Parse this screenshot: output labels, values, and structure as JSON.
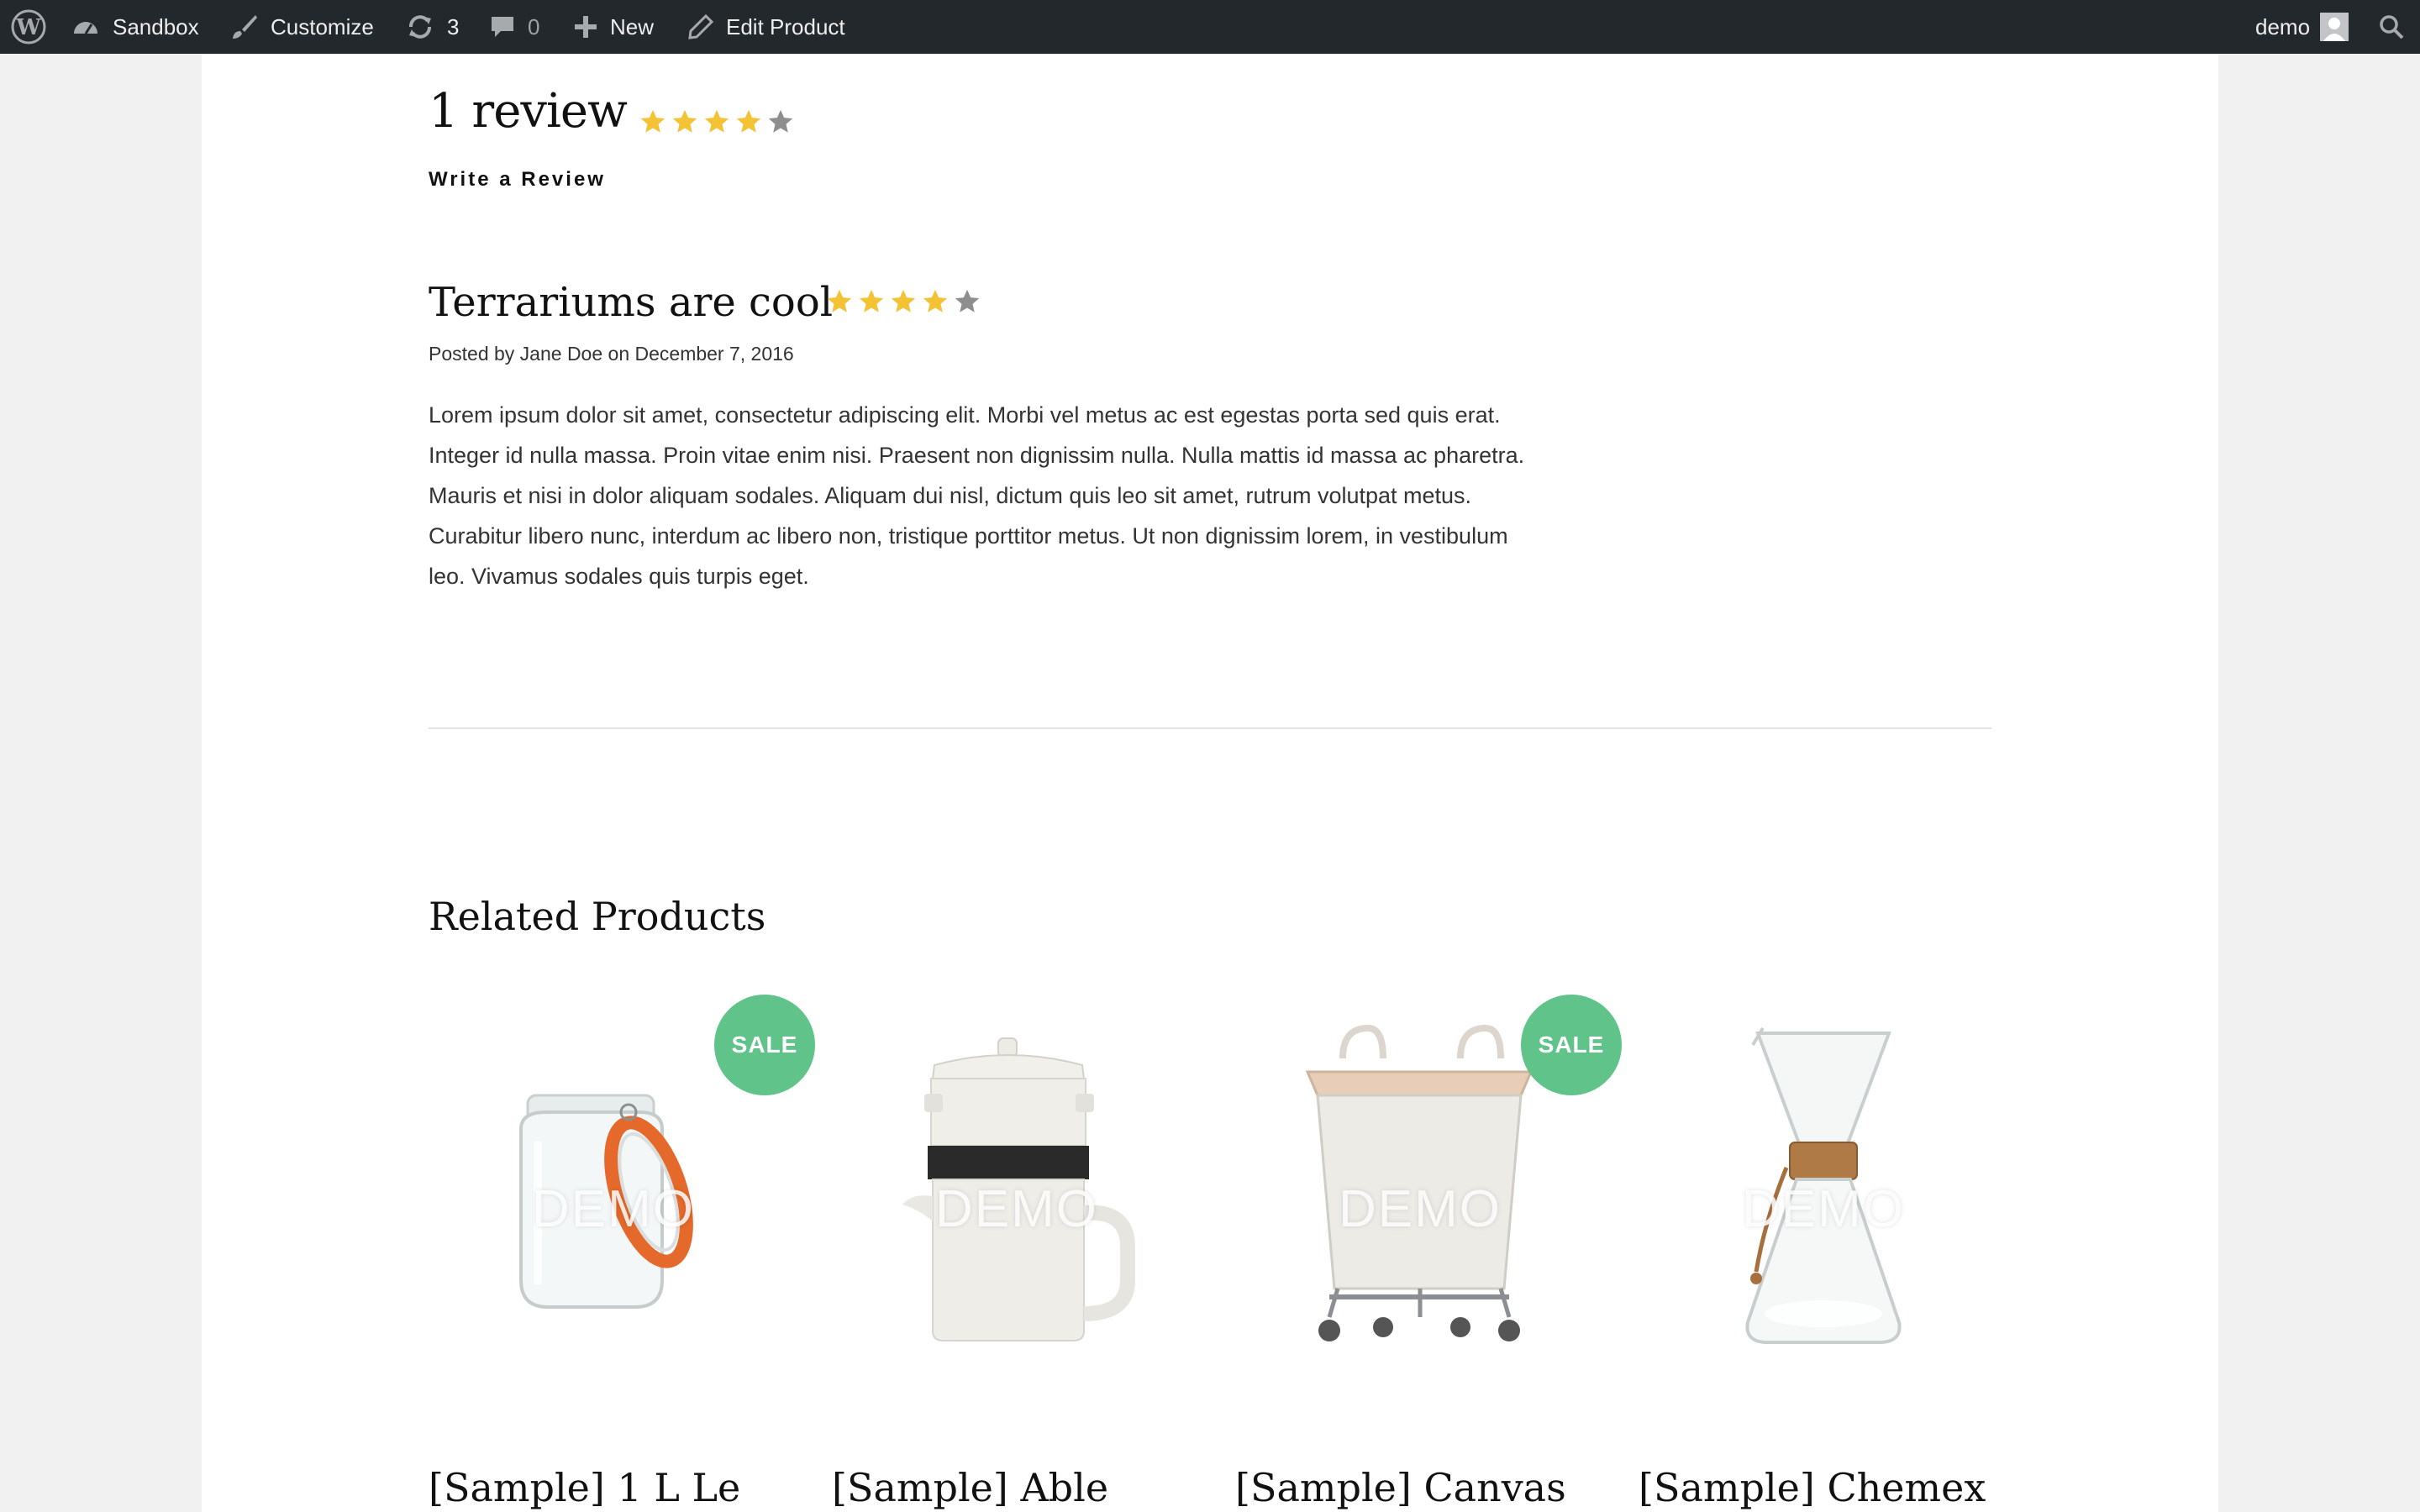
{
  "admin_bar": {
    "site_name": "Sandbox",
    "customize_label": "Customize",
    "updates_count": "3",
    "comments_count": "0",
    "new_label": "New",
    "edit_label": "Edit Product",
    "user_name": "demo"
  },
  "reviews": {
    "heading": "1 review",
    "average_rating": 4,
    "max_rating": 5,
    "write_review_label": "Write a Review",
    "items": [
      {
        "title": "Terrariums are cool",
        "rating": 4,
        "meta": "Posted by Jane Doe on December 7, 2016",
        "body": "Lorem ipsum dolor sit amet, consectetur adipiscing elit. Morbi vel metus ac est egestas porta sed quis erat. Integer id nulla massa. Proin vitae enim nisi. Praesent non dignissim nulla. Nulla mattis id massa ac pharetra. Mauris et nisi in dolor aliquam sodales. Aliquam dui nisl, dictum quis leo sit amet, rutrum volutpat metus. Curabitur libero nunc, interdum ac libero non, tristique porttitor metus. Ut non dignissim lorem, in vestibulum leo. Vivamus sodales quis turpis eget."
      }
    ]
  },
  "related": {
    "heading": "Related Products",
    "watermark": "DEMO",
    "sale_label": "SALE",
    "products": [
      {
        "name": "[Sample] 1 L Le",
        "sale": true,
        "image": "glass-jar"
      },
      {
        "name": "[Sample] Able",
        "sale": false,
        "image": "ceramic-pour-over"
      },
      {
        "name": "[Sample] Canvas",
        "sale": true,
        "image": "canvas-laundry-cart"
      },
      {
        "name": "[Sample] Chemex",
        "sale": false,
        "image": "chemex-carafe"
      }
    ]
  },
  "colors": {
    "admin_bar": "#23282d",
    "star_filled": "#f4c235",
    "star_empty": "#8e8e8e",
    "sale_badge": "#5fc38a"
  }
}
